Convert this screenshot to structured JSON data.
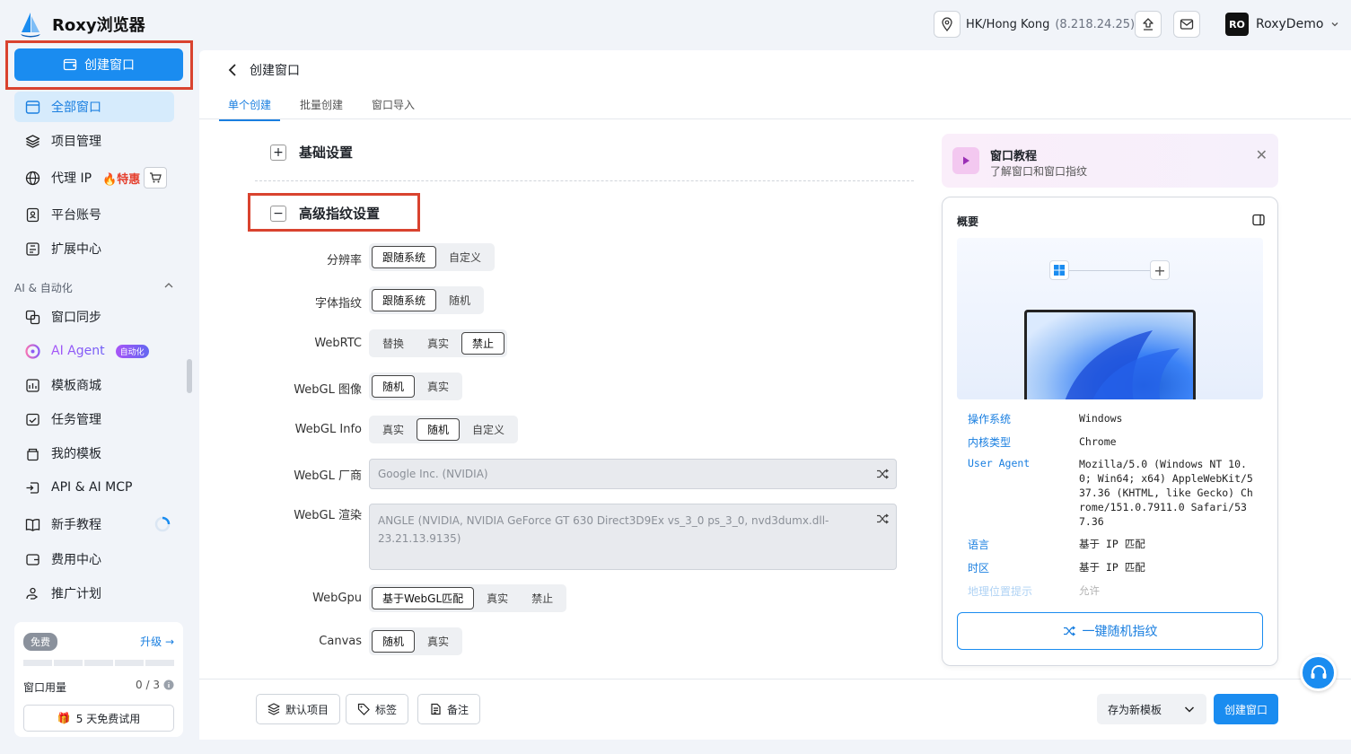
{
  "app": {
    "title": "Roxy浏览器"
  },
  "sidebar": {
    "create_label": "创建窗口",
    "items": [
      {
        "label": "全部窗口"
      },
      {
        "label": "项目管理"
      },
      {
        "label": "代理 IP",
        "tag": "特惠"
      },
      {
        "label": "平台账号"
      },
      {
        "label": "扩展中心"
      }
    ],
    "section_title": "AI & 自动化",
    "ai_items": [
      {
        "label": "窗口同步"
      },
      {
        "label": "AI Agent",
        "tag": "自动化"
      },
      {
        "label": "模板商城"
      },
      {
        "label": "任务管理"
      },
      {
        "label": "我的模板"
      },
      {
        "label": "API & AI MCP"
      },
      {
        "label": "新手教程"
      },
      {
        "label": "费用中心"
      },
      {
        "label": "推广计划"
      }
    ],
    "plan": {
      "tier": "免费",
      "upgrade": "升级",
      "usage_label": "窗口用量",
      "usage_value": "0 / 3",
      "trial": "5 天免费试用"
    }
  },
  "topbar": {
    "ip_location": "HK/Hong Kong",
    "ip_address": "(8.218.24.25)",
    "avatar": "RO",
    "username": "RoxyDemo"
  },
  "page": {
    "title": "创建窗口",
    "tabs": [
      {
        "label": "单个创建"
      },
      {
        "label": "批量创建"
      },
      {
        "label": "窗口导入"
      }
    ],
    "basic_section": "基础设置",
    "advanced_section": "高级指纹设置",
    "rows": {
      "resolution": {
        "label": "分辨率",
        "options": [
          "跟随系统",
          "自定义"
        ]
      },
      "font": {
        "label": "字体指纹",
        "options": [
          "跟随系统",
          "随机"
        ]
      },
      "webrtc": {
        "label": "WebRTC",
        "options": [
          "替换",
          "真实",
          "禁止"
        ]
      },
      "webgl_image": {
        "label": "WebGL 图像",
        "options": [
          "随机",
          "真实"
        ]
      },
      "webgl_info": {
        "label": "WebGL Info",
        "options": [
          "真实",
          "随机",
          "自定义"
        ]
      },
      "webgl_vendor": {
        "label": "WebGL 厂商",
        "value": "Google Inc. (NVIDIA)"
      },
      "webgl_renderer": {
        "label": "WebGL 渲染",
        "value": "ANGLE (NVIDIA, NVIDIA GeForce GT 630 Direct3D9Ex vs_3_0 ps_3_0, nvd3dumx.dll-23.21.13.9135)"
      },
      "webgpu": {
        "label": "WebGpu",
        "options": [
          "基于WebGL匹配",
          "真实",
          "禁止"
        ]
      },
      "canvas": {
        "label": "Canvas",
        "options": [
          "随机",
          "真实"
        ]
      }
    }
  },
  "tutorial": {
    "title": "窗口教程",
    "subtitle": "了解窗口和窗口指纹"
  },
  "overview": {
    "title": "概要",
    "rows": [
      {
        "k": "操作系统",
        "v": "Windows"
      },
      {
        "k": "内核类型",
        "v": "Chrome"
      },
      {
        "k": "User Agent",
        "v": "Mozilla/5.0 (Windows NT 10.0; Win64; x64) AppleWebKit/537.36 (KHTML, like Gecko) Chrome/151.0.7911.0 Safari/537.36"
      },
      {
        "k": "语言",
        "v": "基于 IP 匹配"
      },
      {
        "k": "时区",
        "v": "基于 IP 匹配"
      },
      {
        "k": "地理位置提示",
        "v": "允许"
      }
    ],
    "random_btn": "一键随机指纹"
  },
  "bottom": {
    "default_project": "默认项目",
    "tags": "标签",
    "notes": "备注",
    "save_template": "存为新模板",
    "create": "创建窗口"
  },
  "colors": {
    "accent": "#1a8cf0",
    "highlight_box": "#d9432f"
  }
}
